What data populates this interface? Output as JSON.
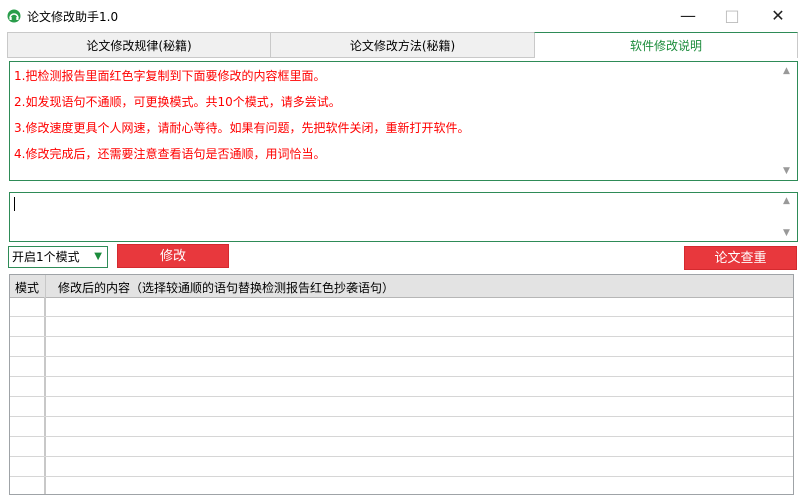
{
  "window": {
    "title": "论文修改助手1.0",
    "app_icon": "app-icon",
    "minimize": "—",
    "maximize": "□",
    "close": "✕"
  },
  "tabs": [
    {
      "label": "论文修改规律(秘籍)"
    },
    {
      "label": "论文修改方法(秘籍)"
    },
    {
      "label": "软件修改说明",
      "active": true
    }
  ],
  "instructions": [
    "1.把检测报告里面红色字复制到下面要修改的内容框里面。",
    "2.如发现语句不通顺，可更换模式。共10个模式，请多尝试。",
    "3.修改速度更具个人网速，请耐心等待。如果有问题，先把软件关闭，重新打开软件。",
    "4.修改完成后，还需要注意查看语句是否通顺，用词恰当。"
  ],
  "input": {
    "value": ""
  },
  "controls": {
    "mode_selected": "开启1个模式",
    "modify_label": "修改",
    "check_label": "论文查重"
  },
  "table": {
    "columns": [
      "模式",
      "修改后的内容（选择较通顺的语句替换检测报告红色抄袭语句）"
    ],
    "rows": []
  },
  "colors": {
    "accent": "#2e8b57",
    "red_button": "#e8383d",
    "instruction_text": "#ff0000",
    "active_tab_text": "#1c8c3c"
  }
}
